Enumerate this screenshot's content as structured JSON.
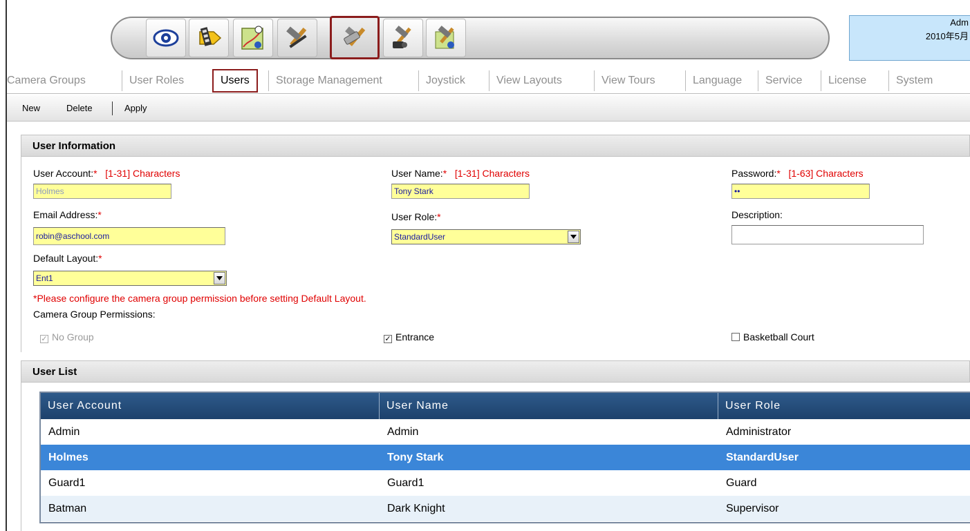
{
  "user_panel": {
    "line1": "Adm",
    "line2": "2010年5月"
  },
  "toolbar": {
    "buttons": [
      {
        "name": "live-view-button",
        "icon": "eye-icon"
      },
      {
        "name": "playback-button",
        "icon": "film-tag-icon"
      },
      {
        "name": "emap-button",
        "icon": "map-icon"
      },
      {
        "name": "settings-button",
        "icon": "hammer-icon"
      },
      {
        "name": "administration-button",
        "icon": "tools-icon"
      },
      {
        "name": "tools-camera-button",
        "icon": "camera-tools-icon"
      },
      {
        "name": "tools-map-button",
        "icon": "map-tools-icon"
      }
    ],
    "selected_index": 4
  },
  "tabs": [
    {
      "label": "Camera Groups"
    },
    {
      "label": "User Roles"
    },
    {
      "label": "Users"
    },
    {
      "label": "Storage Management"
    },
    {
      "label": "Joystick"
    },
    {
      "label": "View Layouts"
    },
    {
      "label": "View Tours"
    },
    {
      "label": "Language"
    },
    {
      "label": "Service"
    },
    {
      "label": "License"
    },
    {
      "label": "System"
    }
  ],
  "active_tab": "Users",
  "commands": {
    "new": "New",
    "delete": "Delete",
    "apply": "Apply"
  },
  "user_info": {
    "title": "User Information",
    "user_account": {
      "label": "User Account:",
      "required": "*",
      "hint": "[1-31] Characters",
      "value": "Holmes"
    },
    "user_name": {
      "label": "User Name:",
      "required": "*",
      "hint": "[1-31] Characters",
      "value": "Tony Stark"
    },
    "password": {
      "label": "Password:",
      "required": "*",
      "hint": "[1-63] Characters",
      "value": "••"
    },
    "email": {
      "label": "Email Address:",
      "required": "*",
      "value": "robin@aschool.com"
    },
    "user_role": {
      "label": "User Role:",
      "required": "*",
      "value": "StandardUser"
    },
    "description": {
      "label": "Description:",
      "value": ""
    },
    "default_layout": {
      "label": "Default Layout:",
      "required": "*",
      "value": "Ent1"
    },
    "warning": "*Please configure the camera group permission before setting Default Layout.",
    "permissions_label": "Camera Group Permissions:",
    "permissions": [
      {
        "label": "No Group",
        "checked": true,
        "disabled": true
      },
      {
        "label": "Entrance",
        "checked": true,
        "disabled": false
      },
      {
        "label": "Basketball Court",
        "checked": false,
        "disabled": false
      }
    ]
  },
  "user_list": {
    "title": "User List",
    "columns": [
      "User Account",
      "User Name",
      "User Role"
    ],
    "rows": [
      {
        "account": "Admin",
        "name": "Admin",
        "role": "Administrator"
      },
      {
        "account": "Holmes",
        "name": "Tony Stark",
        "role": "StandardUser",
        "selected": true
      },
      {
        "account": "Guard1",
        "name": "Guard1",
        "role": "Guard"
      },
      {
        "account": "Batman",
        "name": "Dark Knight",
        "role": "Supervisor"
      }
    ]
  },
  "colors": {
    "required": "#e00000",
    "field_bg": "#ffff99",
    "header_bg": "#1d416c",
    "selected_row": "#3b86d8",
    "highlight_border": "#8b1c1c"
  }
}
